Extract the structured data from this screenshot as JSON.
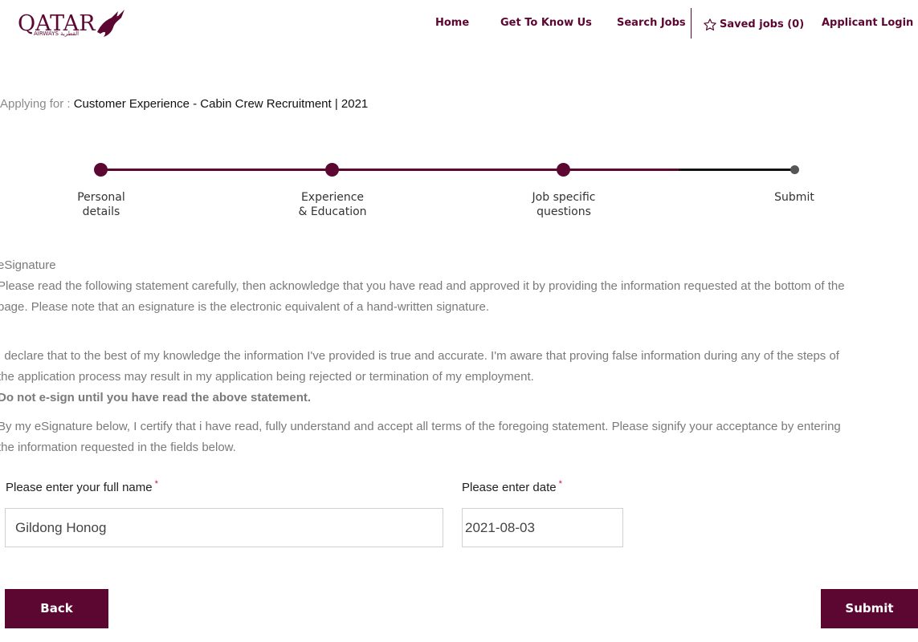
{
  "logo": {
    "brand": "QATAR",
    "sub": "AIRWAYS القطرية"
  },
  "nav": {
    "home": "Home",
    "get_to_know": "Get To Know Us",
    "search_jobs": "Search Jobs",
    "saved_jobs": "Saved jobs (0)",
    "applicant_login": "Applicant Login"
  },
  "applying": {
    "label": "Applying for : ",
    "job_title": "Customer Experience - Cabin Crew Recruitment | 2021"
  },
  "steps": [
    {
      "line1": "Personal",
      "line2": "details"
    },
    {
      "line1": "Experience",
      "line2": "& Education"
    },
    {
      "line1": "Job specific",
      "line2": "questions"
    },
    {
      "line1": "Submit",
      "line2": ""
    }
  ],
  "esign": {
    "heading": "eSignature",
    "intro_1": "Please read the following statement carefully, then acknowledge that you have read and approved it by providing the information requested at the bottom of the",
    "intro_2": "page. Please note that an esignature is the electronic equivalent of a hand-written signature.",
    "declare_1": "I declare that to the best of my knowledge the information I've provided is true and accurate. I'm aware that proving false information during any of the steps of",
    "declare_2": "the application process may result in my application being rejected or termination of my employment.",
    "warning": "Do not e-sign until you have read the above statement.",
    "certify_1": "By my eSignature below, I certify that i have read, fully understand and accept all terms of the foregoing statement. Please signify your acceptance by entering",
    "certify_2": "the information requested in the fields below."
  },
  "form": {
    "name_label": "Please enter your full name",
    "name_value": "Gildong Honog",
    "date_label": "Please enter date",
    "date_value": "2021-08-03",
    "required_mark": "*"
  },
  "buttons": {
    "back": "Back",
    "submit": "Submit"
  },
  "colors": {
    "brand": "#5c0632"
  }
}
